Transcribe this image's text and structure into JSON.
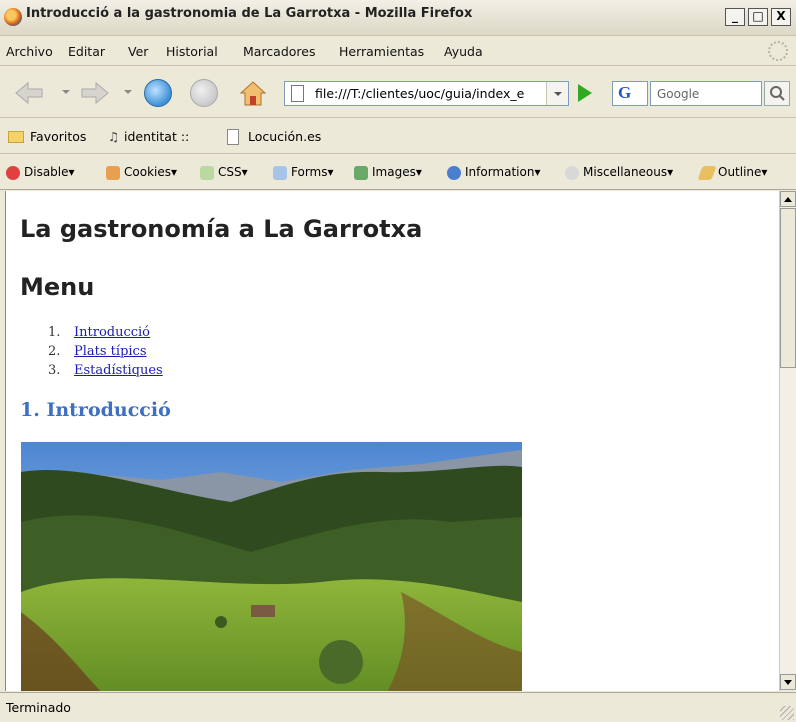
{
  "window": {
    "title": "Introducció a la gastronomia de La Garrotxa - Mozilla Firefox",
    "minimize": "_",
    "maximize": "□",
    "close": "X"
  },
  "menubar": {
    "items": [
      "Archivo",
      "Editar",
      "Ver",
      "Historial",
      "Marcadores",
      "Herramientas",
      "Ayuda"
    ]
  },
  "navbar": {
    "url": "file:///T:/clientes/uoc/guia/index_e",
    "search_engine_letter": "G",
    "search_placeholder": "Google"
  },
  "bookmarks": {
    "items": [
      "Favoritos",
      "identitat ::",
      "Locución.es"
    ]
  },
  "devbar": {
    "items": [
      "Disable▾",
      "Cookies▾",
      "CSS▾",
      "Forms▾",
      "Images▾",
      "Information▾",
      "Miscellaneous▾",
      "Outline▾"
    ]
  },
  "page": {
    "title": "La gastronomía a La Garrotxa",
    "menu_heading": "Menu",
    "menu_items": [
      {
        "num": "1.",
        "label": "Introducció"
      },
      {
        "num": "2.",
        "label": "Plats típics"
      },
      {
        "num": "3.",
        "label": "Estadístiques"
      }
    ],
    "section_heading": "1. Introducció"
  },
  "status": {
    "text": "Terminado"
  },
  "colors": {
    "link": "#1a1ab5",
    "section_heading": "#3d6fc2",
    "chrome": "#ece9d8"
  }
}
